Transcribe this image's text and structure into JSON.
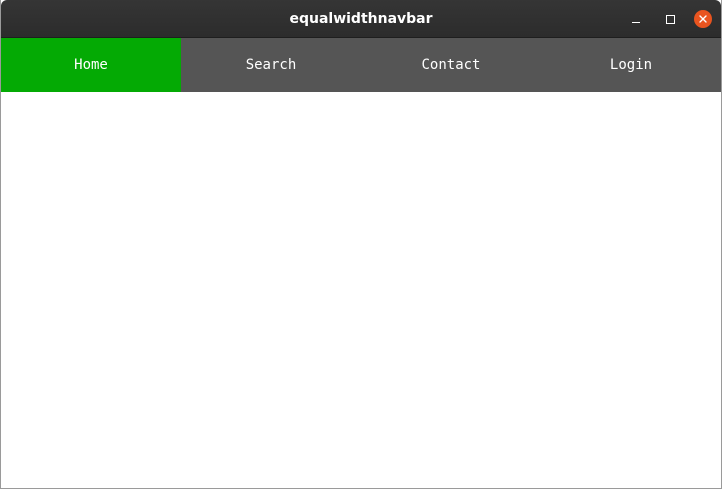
{
  "window": {
    "title": "equalwidthnavbar",
    "controls": {
      "minimize_icon": "minimize-icon",
      "maximize_icon": "maximize-icon",
      "close_icon": "close-icon",
      "close_color": "#e9541f"
    }
  },
  "navbar": {
    "background": "#555555",
    "active_color": "#04aa04",
    "items": [
      {
        "label": "Home",
        "active": true
      },
      {
        "label": "Search",
        "active": false
      },
      {
        "label": "Contact",
        "active": false
      },
      {
        "label": "Login",
        "active": false
      }
    ]
  }
}
